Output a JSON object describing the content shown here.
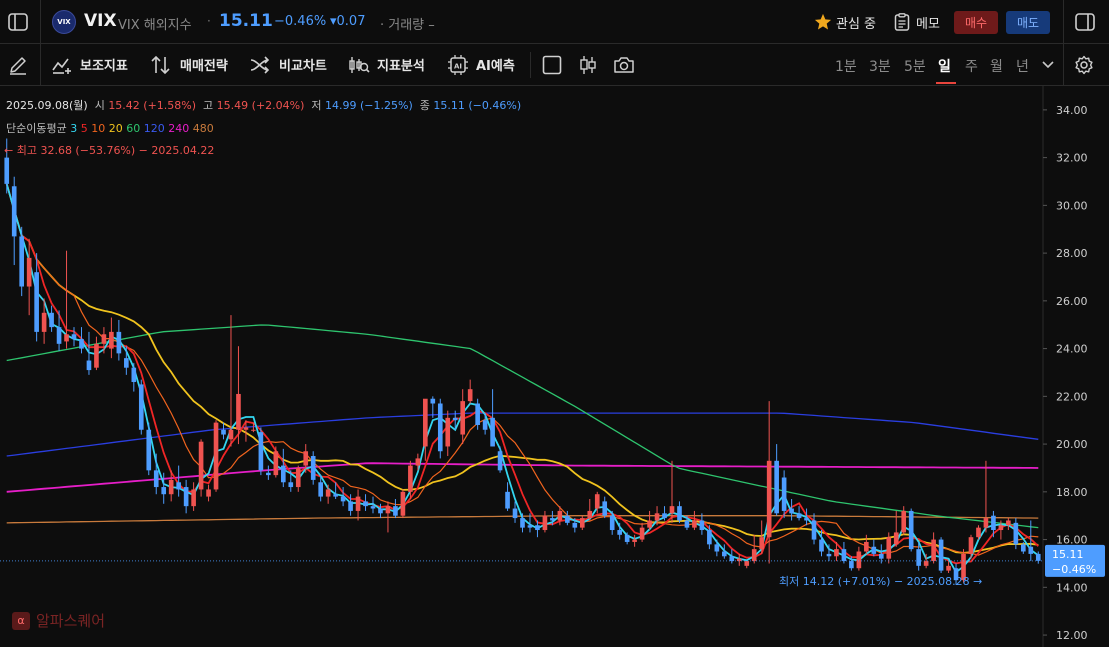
{
  "header": {
    "symbol_badge": "VIX",
    "symbol": "VIX",
    "symbol_sub": "VIX  해외지수",
    "sep": "·",
    "price": "15.11",
    "change_pct": "−0.46%",
    "change": "▾0.07",
    "volume": "· 거래량 –",
    "watchlist": "관심 중",
    "memo": "메모",
    "buy": "매수",
    "sell": "매도"
  },
  "toolbar": {
    "indicators": "보조지표",
    "strategy": "매매전략",
    "compare": "비교차트",
    "analysis": "지표분석",
    "ai": "AI예측",
    "timeframes": [
      "1분",
      "3분",
      "5분",
      "일",
      "주",
      "월",
      "년"
    ],
    "active_timeframe": "일"
  },
  "legend": {
    "date": "2025.09.08(월)",
    "open_label": "시",
    "open": "15.42 (+1.58%)",
    "high_label": "고",
    "high": "15.49 (+2.04%)",
    "low_label": "저",
    "low": "14.99 (−1.25%)",
    "close_label": "종",
    "close": "15.11 (−0.46%)",
    "ma_label": "단순이동평균",
    "ma_periods": [
      "3",
      "5",
      "10",
      "20",
      "60",
      "120",
      "240",
      "480"
    ],
    "max_note": "← 최고 32.68 (−53.76%) − 2025.04.22",
    "min_note": "최저 14.12 (+7.01%) − 2025.08.28 →"
  },
  "watermark": {
    "text": "알파스퀘어",
    "glyph": "α"
  },
  "colors": {
    "up": "#ef5350",
    "down": "#4e9dff",
    "ma3": "#33d6f0",
    "ma5": "#f02626",
    "ma10": "#f0641e",
    "ma20": "#f0c31e",
    "ma60": "#2ec46e",
    "ma120": "#2a3ee0",
    "ma240": "#e61ec8",
    "ma480": "#c87a3c"
  },
  "chart_data": {
    "type": "candlestick",
    "ylim": [
      11.5,
      35
    ],
    "yticks": [
      "12.00",
      "14.00",
      "16.00",
      "18.00",
      "20.00",
      "22.00",
      "24.00",
      "26.00",
      "28.00",
      "30.00",
      "32.00",
      "34.00"
    ],
    "last_price_tag": {
      "price": "15.11",
      "pct": "−0.46%"
    },
    "candles": [
      [
        32.0,
        32.8,
        30.5,
        30.9
      ],
      [
        30.8,
        31.2,
        27.5,
        28.7
      ],
      [
        28.7,
        29.1,
        26.2,
        26.6
      ],
      [
        26.6,
        28.6,
        25.4,
        27.8
      ],
      [
        27.2,
        28.0,
        24.3,
        24.7
      ],
      [
        24.7,
        26.1,
        24.2,
        25.5
      ],
      [
        25.5,
        25.8,
        24.7,
        24.9
      ],
      [
        24.9,
        25.6,
        23.9,
        24.2
      ],
      [
        24.3,
        28.1,
        24.0,
        24.6
      ],
      [
        24.6,
        24.9,
        24.1,
        24.4
      ],
      [
        24.4,
        24.9,
        23.8,
        24.0
      ],
      [
        23.5,
        24.7,
        22.9,
        23.1
      ],
      [
        23.2,
        24.5,
        23.1,
        24.2
      ],
      [
        24.2,
        24.9,
        23.8,
        24.6
      ],
      [
        24.0,
        25.3,
        23.6,
        24.7
      ],
      [
        24.7,
        25.2,
        23.5,
        23.8
      ],
      [
        23.6,
        24.1,
        22.9,
        23.2
      ],
      [
        23.2,
        23.4,
        22.2,
        22.6
      ],
      [
        22.5,
        22.7,
        20.4,
        20.6
      ],
      [
        20.6,
        20.9,
        18.7,
        18.9
      ],
      [
        18.9,
        19.6,
        17.9,
        18.2
      ],
      [
        18.2,
        18.8,
        17.5,
        17.9
      ],
      [
        17.9,
        18.9,
        17.6,
        18.5
      ],
      [
        18.4,
        19.1,
        17.8,
        18.1
      ],
      [
        18.2,
        18.5,
        17.1,
        17.4
      ],
      [
        17.4,
        18.4,
        17.2,
        18.1
      ],
      [
        18.1,
        20.2,
        17.8,
        20.1
      ],
      [
        17.8,
        18.3,
        17.6,
        18.1
      ],
      [
        18.1,
        21.0,
        18.0,
        20.9
      ],
      [
        20.6,
        20.9,
        20.2,
        20.4
      ],
      [
        20.2,
        25.4,
        19.9,
        20.6
      ],
      [
        20.6,
        24.1,
        20.0,
        22.1
      ],
      [
        20.6,
        21.0,
        20.1,
        20.7
      ],
      [
        20.6,
        20.9,
        20.5,
        20.6
      ],
      [
        20.5,
        20.7,
        18.7,
        18.9
      ],
      [
        18.8,
        19.1,
        18.5,
        18.7
      ],
      [
        18.7,
        19.9,
        18.6,
        19.7
      ],
      [
        19.1,
        19.8,
        18.2,
        18.4
      ],
      [
        18.4,
        18.9,
        18.0,
        18.2
      ],
      [
        18.2,
        19.1,
        18.0,
        19.0
      ],
      [
        19.1,
        20.0,
        18.8,
        19.7
      ],
      [
        19.5,
        19.7,
        18.3,
        18.5
      ],
      [
        18.4,
        18.7,
        17.6,
        17.8
      ],
      [
        17.8,
        18.3,
        17.5,
        18.1
      ],
      [
        17.9,
        18.4,
        17.7,
        17.8
      ],
      [
        17.8,
        18.2,
        17.4,
        17.6
      ],
      [
        17.6,
        17.9,
        17.0,
        17.2
      ],
      [
        17.2,
        18.1,
        16.8,
        17.8
      ],
      [
        17.6,
        17.9,
        17.2,
        17.4
      ],
      [
        17.4,
        17.8,
        17.1,
        17.3
      ],
      [
        17.3,
        17.5,
        16.9,
        17.1
      ],
      [
        17.1,
        17.6,
        16.3,
        17.4
      ],
      [
        17.4,
        17.7,
        16.9,
        17.0
      ],
      [
        17.0,
        18.1,
        16.9,
        18.0
      ],
      [
        18.0,
        19.3,
        17.7,
        19.1
      ],
      [
        19.1,
        19.6,
        18.9,
        19.4
      ],
      [
        19.9,
        20.2,
        19.3,
        21.9
      ],
      [
        21.9,
        22.0,
        21.1,
        21.7
      ],
      [
        21.7,
        21.9,
        19.4,
        19.7
      ],
      [
        19.9,
        21.4,
        19.5,
        21.1
      ],
      [
        21.1,
        21.4,
        20.6,
        21.0
      ],
      [
        20.4,
        22.3,
        20.0,
        21.8
      ],
      [
        21.8,
        22.7,
        21.7,
        22.3
      ],
      [
        21.7,
        21.9,
        20.6,
        20.8
      ],
      [
        21.0,
        21.3,
        20.4,
        20.6
      ],
      [
        21.1,
        22.3,
        19.9,
        19.9
      ],
      [
        19.7,
        19.9,
        18.8,
        18.9
      ],
      [
        18.0,
        18.4,
        17.2,
        17.3
      ],
      [
        17.3,
        17.6,
        16.7,
        16.9
      ],
      [
        16.9,
        17.1,
        16.3,
        16.5
      ],
      [
        16.6,
        17.1,
        16.3,
        16.5
      ],
      [
        16.6,
        16.8,
        16.1,
        16.4
      ],
      [
        16.4,
        17.2,
        16.3,
        17.0
      ],
      [
        16.9,
        17.2,
        16.6,
        16.8
      ],
      [
        16.8,
        17.4,
        16.6,
        17.2
      ],
      [
        17.0,
        17.2,
        16.6,
        16.7
      ],
      [
        16.7,
        16.9,
        16.3,
        16.5
      ],
      [
        16.5,
        17.0,
        16.4,
        16.9
      ],
      [
        16.9,
        17.7,
        16.8,
        17.2
      ],
      [
        17.3,
        18.0,
        17.1,
        17.9
      ],
      [
        17.6,
        17.8,
        16.9,
        17.0
      ],
      [
        17.0,
        17.2,
        16.2,
        16.4
      ],
      [
        16.4,
        16.7,
        16.0,
        16.2
      ],
      [
        16.2,
        16.3,
        15.8,
        15.9
      ],
      [
        15.9,
        16.2,
        15.7,
        16.0
      ],
      [
        16.0,
        16.7,
        15.9,
        16.5
      ],
      [
        16.5,
        17.2,
        16.4,
        16.8
      ],
      [
        16.8,
        17.4,
        16.6,
        17.1
      ],
      [
        17.1,
        17.4,
        16.8,
        16.9
      ],
      [
        17.1,
        19.3,
        16.7,
        17.4
      ],
      [
        17.4,
        17.6,
        16.7,
        16.8
      ],
      [
        16.8,
        17.0,
        16.4,
        16.5
      ],
      [
        16.5,
        17.2,
        16.4,
        16.8
      ],
      [
        16.8,
        17.1,
        16.2,
        16.4
      ],
      [
        16.4,
        16.6,
        15.6,
        15.8
      ],
      [
        15.8,
        16.0,
        15.3,
        15.5
      ],
      [
        15.5,
        15.8,
        15.2,
        15.3
      ],
      [
        15.3,
        15.6,
        15.0,
        15.1
      ],
      [
        15.1,
        15.4,
        14.9,
        15.2
      ],
      [
        14.9,
        15.1,
        14.8,
        15.1
      ],
      [
        15.1,
        16.2,
        15.0,
        15.6
      ],
      [
        15.6,
        16.8,
        15.4,
        16.1
      ],
      [
        16.1,
        21.8,
        15.0,
        19.3
      ],
      [
        19.3,
        20.0,
        17.0,
        17.1
      ],
      [
        18.6,
        18.9,
        16.9,
        17.2
      ],
      [
        17.3,
        17.7,
        16.8,
        17.1
      ],
      [
        17.1,
        17.4,
        16.8,
        16.9
      ],
      [
        16.9,
        17.3,
        16.6,
        16.8
      ],
      [
        16.8,
        17.1,
        15.8,
        16.0
      ],
      [
        16.0,
        16.4,
        15.3,
        15.5
      ],
      [
        15.4,
        15.8,
        15.1,
        15.3
      ],
      [
        15.3,
        15.9,
        15.1,
        15.6
      ],
      [
        15.6,
        15.9,
        15.0,
        15.1
      ],
      [
        15.1,
        15.3,
        14.7,
        14.8
      ],
      [
        14.8,
        15.7,
        14.7,
        15.5
      ],
      [
        15.5,
        16.2,
        15.4,
        15.9
      ],
      [
        15.7,
        16.0,
        15.3,
        15.4
      ],
      [
        15.4,
        15.8,
        15.0,
        15.2
      ],
      [
        15.2,
        16.3,
        15.0,
        16.1
      ],
      [
        15.8,
        17.2,
        15.7,
        16.3
      ],
      [
        16.3,
        17.4,
        16.2,
        17.2
      ],
      [
        17.2,
        17.3,
        15.5,
        15.6
      ],
      [
        15.6,
        15.9,
        14.7,
        14.9
      ],
      [
        14.9,
        15.4,
        14.8,
        15.1
      ],
      [
        15.1,
        16.3,
        15.0,
        16.0
      ],
      [
        16.0,
        16.1,
        14.6,
        14.7
      ],
      [
        14.7,
        15.1,
        14.6,
        14.9
      ],
      [
        14.8,
        15.0,
        14.1,
        14.3
      ],
      [
        14.3,
        15.6,
        14.2,
        15.4
      ],
      [
        15.4,
        16.2,
        15.2,
        16.1
      ],
      [
        16.1,
        16.6,
        16.0,
        16.5
      ],
      [
        16.5,
        19.3,
        16.3,
        16.9
      ],
      [
        17.0,
        17.2,
        16.1,
        16.4
      ],
      [
        16.4,
        16.8,
        16.0,
        16.6
      ],
      [
        16.6,
        16.9,
        16.4,
        16.8
      ],
      [
        16.7,
        16.9,
        15.6,
        15.8
      ],
      [
        15.8,
        15.9,
        15.4,
        15.5
      ],
      [
        15.7,
        16.8,
        15.1,
        15.4
      ],
      [
        15.4,
        15.5,
        14.99,
        15.11
      ]
    ]
  }
}
